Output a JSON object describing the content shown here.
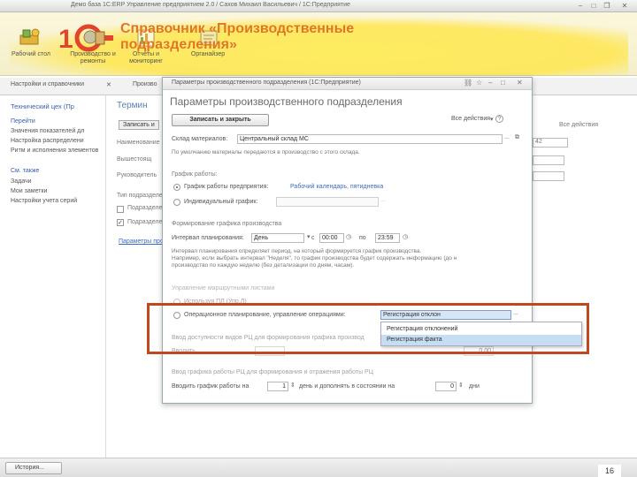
{
  "app": {
    "window_title": "Демо база 1С:ERP Управление предприятием 2.0 / Сахов Михаил Васильевич / 1С:Предприятие"
  },
  "title_overlay": "Справочник «Производственные подразделения»",
  "ribbon": {
    "buttons": [
      {
        "label": "Рабочий стол",
        "icon": "desktop-icon"
      },
      {
        "label": "Производство и ремонты",
        "icon": "production-icon"
      },
      {
        "label": "Отчеты и мониторинг",
        "icon": "report-icon"
      },
      {
        "label": "Органайзер",
        "icon": "organizer-icon"
      }
    ]
  },
  "app_tabs": {
    "tab1": "Настройки и справочники",
    "tab2": "Произво"
  },
  "left_panel": {
    "title": "Технический цех (Пр",
    "go_header": "Перейти",
    "go_items": [
      "Значения показателей дл",
      "Настройка распределени",
      "Ритм и исполнения элементов"
    ],
    "see_also_header": "См. также",
    "see_also_items": [
      "Задачи",
      "Мои заметки",
      "Настройки учета серий"
    ]
  },
  "bg_form": {
    "title": "Термин",
    "save_button": "Записать и",
    "rows": [
      "Наименование",
      "Вышестоящ",
      "Руководитель"
    ],
    "type_label": "Тип подразделения",
    "check1": "Подразделение",
    "check2": "Подразделение",
    "params_link": "Параметры производ",
    "all_actions": "Все действия",
    "number": "42"
  },
  "dialog": {
    "window_title": "Параметры производственного подразделения (1С:Предприятие)",
    "header": "Параметры производственного подразделения",
    "save_close": "Записать и закрыть",
    "all_actions": "Все действия",
    "materials_label": "Склад материалов:",
    "materials_value": "Центральный склад МС",
    "materials_note": "По умолчанию материалы передаются в производство с этого склада.",
    "schedule_section": "График работы:",
    "radio_enterprise": "График работы предприятия:",
    "enterprise_link": "Рабочий календарь, пятидневка",
    "radio_individual": "Индивидуальный график:",
    "planning_section": "Формирование графика производства",
    "interval_label": "Интервал планирования:",
    "interval_value": "День",
    "from_label": "с",
    "from_value": "00:00",
    "to_label": "по",
    "to_value": "23:59",
    "planning_note_lines": [
      "Интервал планирования определяет период, на который формируется график производства.",
      "Например, если выбрать интервал \"Неделя\", то график производства будет содержать информацию (до н",
      "производство по каждую неделю (без детализации по дням, часам)."
    ],
    "usage_section": "Управление маршрутными листами",
    "radio_usage1": "Используя ПЛ (Упр.Л)",
    "radio_operational": "Операционное планирование, управление операциями:",
    "operational_value": "Регистрация отклон",
    "ruled_text": "Ввод доступности видов РЦ для формирования графика производ",
    "ruled_text2": "Вводить",
    "pct_value": "0,00",
    "schedule_rc_text": "Ввод графика работы РЦ для формирования и отражения работы РЦ",
    "input_schedule_label": "Вводить график работы на",
    "days1": "1",
    "days_mid": "день и дополнять в состоянии на",
    "days2": "0",
    "days_end": "дни"
  },
  "dropdown": {
    "items": [
      "Регистрация отклонений",
      "Регистрация факта"
    ],
    "selected_index": 1
  },
  "status": {
    "history_button": "История...",
    "page_number": "16"
  },
  "colors": {
    "title_orange": "#e2761b",
    "highlight_red": "#c0471e",
    "link_blue": "#3b6bbf",
    "selection_blue": "#c6def4"
  }
}
